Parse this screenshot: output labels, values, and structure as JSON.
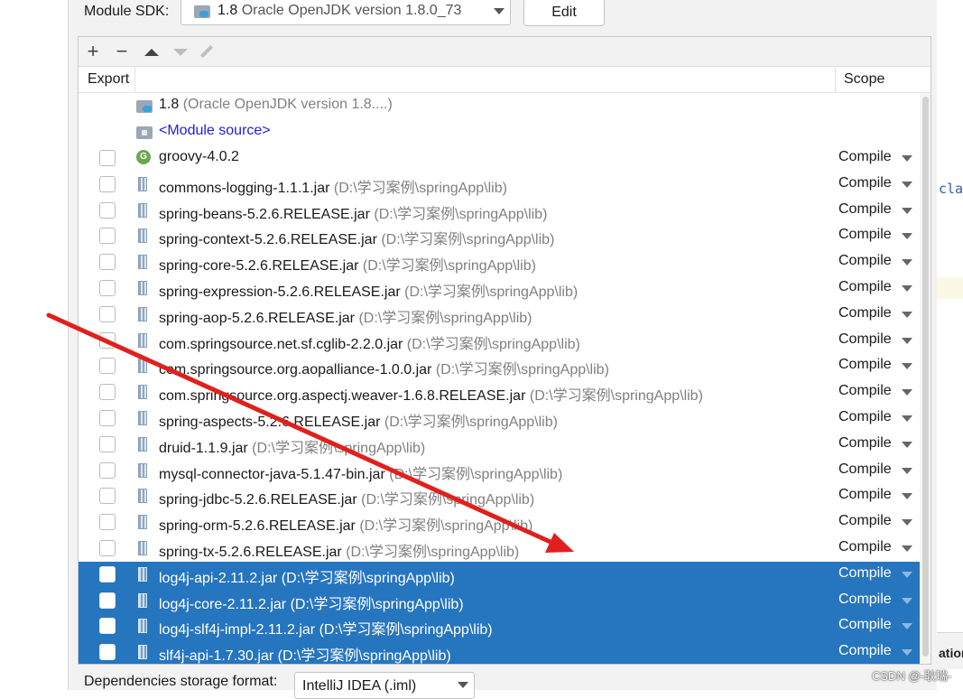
{
  "module_sdk": {
    "label": "Module SDK:",
    "version": "1.8",
    "name": "Oracle OpenJDK version 1.8.0_73",
    "edit_label": "Edit"
  },
  "toolbar": {
    "add": "+",
    "remove": "−"
  },
  "table": {
    "col_export": "Export",
    "col_scope": "Scope",
    "sdk_entry": {
      "version": "1.8",
      "name": "(Oracle OpenJDK version 1.8....)"
    },
    "module_source": "<Module source>",
    "rows": [
      {
        "name": "groovy-4.0.2",
        "path": "",
        "scope": "Compile",
        "icon": "groovy-icon",
        "selected": false
      },
      {
        "name": "commons-logging-1.1.1.jar",
        "path": "(D:\\学习案例\\springApp\\lib)",
        "scope": "Compile",
        "icon": "jar-icon",
        "selected": false
      },
      {
        "name": "spring-beans-5.2.6.RELEASE.jar",
        "path": "(D:\\学习案例\\springApp\\lib)",
        "scope": "Compile",
        "icon": "jar-icon",
        "selected": false
      },
      {
        "name": "spring-context-5.2.6.RELEASE.jar",
        "path": "(D:\\学习案例\\springApp\\lib)",
        "scope": "Compile",
        "icon": "jar-icon",
        "selected": false
      },
      {
        "name": "spring-core-5.2.6.RELEASE.jar",
        "path": "(D:\\学习案例\\springApp\\lib)",
        "scope": "Compile",
        "icon": "jar-icon",
        "selected": false
      },
      {
        "name": "spring-expression-5.2.6.RELEASE.jar",
        "path": "(D:\\学习案例\\springApp\\lib)",
        "scope": "Compile",
        "icon": "jar-icon",
        "selected": false
      },
      {
        "name": "spring-aop-5.2.6.RELEASE.jar",
        "path": "(D:\\学习案例\\springApp\\lib)",
        "scope": "Compile",
        "icon": "jar-icon",
        "selected": false
      },
      {
        "name": "com.springsource.net.sf.cglib-2.2.0.jar",
        "path": "(D:\\学习案例\\springApp\\lib)",
        "scope": "Compile",
        "icon": "jar-icon",
        "selected": false
      },
      {
        "name": "com.springsource.org.aopalliance-1.0.0.jar",
        "path": "(D:\\学习案例\\springApp\\lib)",
        "scope": "Compile",
        "icon": "jar-icon",
        "selected": false
      },
      {
        "name": "com.springsource.org.aspectj.weaver-1.6.8.RELEASE.jar",
        "path": "(D:\\学习案例\\springApp\\lib)",
        "scope": "Compile",
        "icon": "jar-icon",
        "selected": false
      },
      {
        "name": "spring-aspects-5.2.6.RELEASE.jar",
        "path": "(D:\\学习案例\\springApp\\lib)",
        "scope": "Compile",
        "icon": "jar-icon",
        "selected": false
      },
      {
        "name": "druid-1.1.9.jar",
        "path": "(D:\\学习案例\\springApp\\lib)",
        "scope": "Compile",
        "icon": "jar-icon",
        "selected": false
      },
      {
        "name": "mysql-connector-java-5.1.47-bin.jar",
        "path": "(D:\\学习案例\\springApp\\lib)",
        "scope": "Compile",
        "icon": "jar-icon",
        "selected": false
      },
      {
        "name": "spring-jdbc-5.2.6.RELEASE.jar",
        "path": "(D:\\学习案例\\springApp\\lib)",
        "scope": "Compile",
        "icon": "jar-icon",
        "selected": false
      },
      {
        "name": "spring-orm-5.2.6.RELEASE.jar",
        "path": "(D:\\学习案例\\springApp\\lib)",
        "scope": "Compile",
        "icon": "jar-icon",
        "selected": false
      },
      {
        "name": "spring-tx-5.2.6.RELEASE.jar",
        "path": "(D:\\学习案例\\springApp\\lib)",
        "scope": "Compile",
        "icon": "jar-icon",
        "selected": false
      },
      {
        "name": "log4j-api-2.11.2.jar",
        "path": "(D:\\学习案例\\springApp\\lib)",
        "scope": "Compile",
        "icon": "jar-icon",
        "selected": true
      },
      {
        "name": "log4j-core-2.11.2.jar",
        "path": "(D:\\学习案例\\springApp\\lib)",
        "scope": "Compile",
        "icon": "jar-icon",
        "selected": true
      },
      {
        "name": "log4j-slf4j-impl-2.11.2.jar",
        "path": "(D:\\学习案例\\springApp\\lib)",
        "scope": "Compile",
        "icon": "jar-icon",
        "selected": true
      },
      {
        "name": "slf4j-api-1.7.30.jar",
        "path": "(D:\\学习案例\\springApp\\lib)",
        "scope": "Compile",
        "icon": "jar-icon",
        "selected": true
      }
    ]
  },
  "storage": {
    "label": "Dependencies storage format:",
    "value": "IntelliJ IDEA (.iml)"
  },
  "background_editor": {
    "code_fragment": "cla",
    "panel_fragment": "ation"
  },
  "watermark": "CSDN @-耿瑞-",
  "colors": {
    "selection": "#2675bf",
    "annotation_arrow": "#e0201c",
    "path_text": "#808080",
    "module_source": "#2121d8"
  }
}
